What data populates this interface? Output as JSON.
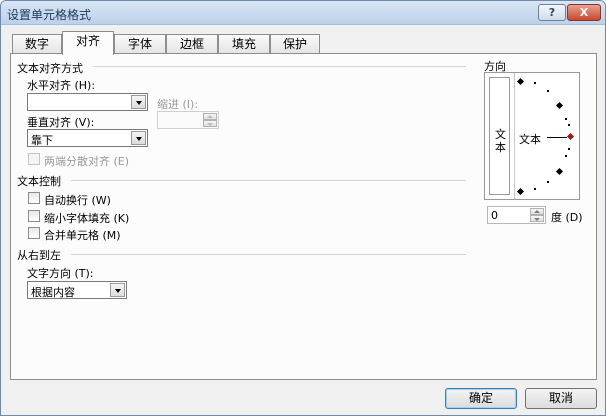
{
  "window": {
    "title": "设置单元格格式"
  },
  "titlebar_buttons": {
    "help": "?",
    "close": "X"
  },
  "tabs": [
    "数字",
    "对齐",
    "字体",
    "边框",
    "填充",
    "保护"
  ],
  "active_tab": "对齐",
  "text_alignment": {
    "group_title": "文本对齐方式",
    "horizontal_label": "水平对齐 (H):",
    "horizontal_value": "",
    "indent_label": "缩进 (I):",
    "indent_value": "",
    "vertical_label": "垂直对齐 (V):",
    "vertical_value": "靠下",
    "justify_distributed_label": "两端分散对齐 (E)"
  },
  "text_control": {
    "group_title": "文本控制",
    "wrap_text": "自动换行 (W)",
    "shrink_to_fit": "缩小字体填充 (K)",
    "merge_cells": "合并单元格 (M)"
  },
  "rtl": {
    "group_title": "从右到左",
    "direction_label": "文字方向 (T):",
    "direction_value": "根据内容"
  },
  "orientation": {
    "title": "方向",
    "vertical_text": [
      "文",
      "本"
    ],
    "preview_text": "文本",
    "degrees_value": "0",
    "degrees_label": "度 (D)"
  },
  "footer": {
    "ok": "确定",
    "cancel": "取消"
  }
}
